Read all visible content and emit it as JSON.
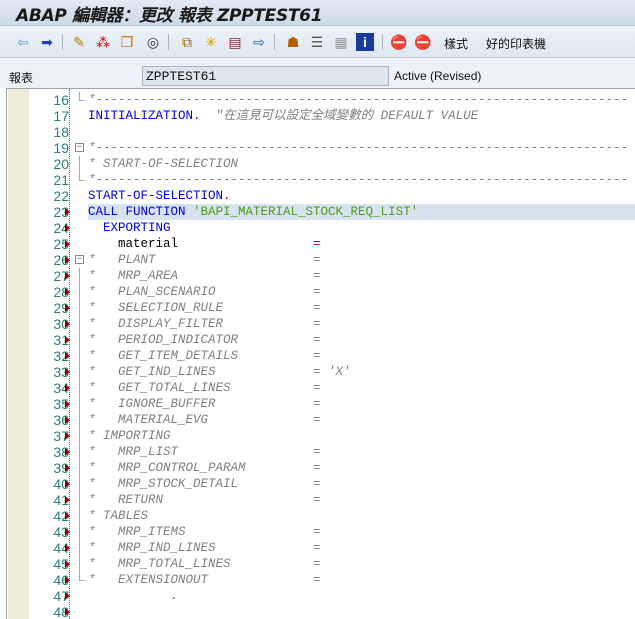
{
  "title": "ABAP 編輯器：更改 報表 ZPPTEST61",
  "toolbar": {
    "icons": [
      "back-arrow-icon",
      "forward-arrow-icon",
      "display-change-icon",
      "active-inactive-icon",
      "other-object-icon",
      "check-icon",
      "activate-icon",
      "test-icon",
      "where-used-icon",
      "navigation-window-icon",
      "object-list-icon",
      "help-icon",
      "info-icon",
      "breakpoint-icon",
      "session-breakpoint-icon"
    ],
    "pattern_label": "樣式",
    "pretty_printer_label": "好的印表機"
  },
  "info": {
    "label": "報表",
    "program": "ZPPTEST61",
    "status": "Active (Revised)"
  },
  "colors": {
    "keyword": "#0000e6",
    "string": "#4a9e1a",
    "comment": "#808080",
    "operator": "#a0006e",
    "highlight": "#d8e3f0"
  },
  "lines": [
    {
      "n": "16",
      "segs": [
        [
          "cmt",
          "*-----------------------------------------------------------------------"
        ]
      ]
    },
    {
      "n": "17",
      "segs": [
        [
          "kw",
          "INITIALIZATION"
        ],
        [
          "op",
          "."
        ],
        [
          "pl",
          "  "
        ],
        [
          "cmt",
          "\"在這見可以設定全域變數的 DEFAULT VALUE"
        ]
      ]
    },
    {
      "n": "18",
      "segs": []
    },
    {
      "n": "19",
      "segs": [
        [
          "cmt",
          "*-----------------------------------------------------------------------"
        ]
      ]
    },
    {
      "n": "20",
      "segs": [
        [
          "cmt",
          "* START-OF-SELECTION"
        ]
      ]
    },
    {
      "n": "21",
      "segs": [
        [
          "cmt",
          "*-----------------------------------------------------------------------"
        ]
      ]
    },
    {
      "n": "22",
      "segs": [
        [
          "kw",
          "START-OF-SELECTION"
        ],
        [
          "op",
          "."
        ]
      ]
    },
    {
      "n": "23",
      "segs": [
        [
          "kw",
          "CALL FUNCTION "
        ],
        [
          "str",
          "'BAPI_MATERIAL_STOCK_REQ_LIST'"
        ]
      ]
    },
    {
      "n": "24",
      "segs": [
        [
          "kw",
          "  EXPORTING"
        ]
      ]
    },
    {
      "n": "25",
      "segs": [
        [
          "pl",
          "    material                  "
        ],
        [
          "op",
          "="
        ]
      ]
    },
    {
      "n": "26",
      "segs": [
        [
          "cmt",
          "*   PLANT                     ="
        ]
      ]
    },
    {
      "n": "27",
      "segs": [
        [
          "cmt",
          "*   MRP_AREA                  ="
        ]
      ]
    },
    {
      "n": "28",
      "segs": [
        [
          "cmt",
          "*   PLAN_SCENARIO             ="
        ]
      ]
    },
    {
      "n": "29",
      "segs": [
        [
          "cmt",
          "*   SELECTION_RULE            ="
        ]
      ]
    },
    {
      "n": "30",
      "segs": [
        [
          "cmt",
          "*   DISPLAY_FILTER            ="
        ]
      ]
    },
    {
      "n": "31",
      "segs": [
        [
          "cmt",
          "*   PERIOD_INDICATOR          ="
        ]
      ]
    },
    {
      "n": "32",
      "segs": [
        [
          "cmt",
          "*   GET_ITEM_DETAILS          ="
        ]
      ]
    },
    {
      "n": "33",
      "segs": [
        [
          "cmt",
          "*   GET_IND_LINES             = 'X'"
        ]
      ]
    },
    {
      "n": "34",
      "segs": [
        [
          "cmt",
          "*   GET_TOTAL_LINES           ="
        ]
      ]
    },
    {
      "n": "35",
      "segs": [
        [
          "cmt",
          "*   IGNORE_BUFFER             ="
        ]
      ]
    },
    {
      "n": "36",
      "segs": [
        [
          "cmt",
          "*   MATERIAL_EVG              ="
        ]
      ]
    },
    {
      "n": "37",
      "segs": [
        [
          "cmt",
          "* IMPORTING"
        ]
      ]
    },
    {
      "n": "38",
      "segs": [
        [
          "cmt",
          "*   MRP_LIST                  ="
        ]
      ]
    },
    {
      "n": "39",
      "segs": [
        [
          "cmt",
          "*   MRP_CONTROL_PARAM         ="
        ]
      ]
    },
    {
      "n": "40",
      "segs": [
        [
          "cmt",
          "*   MRP_STOCK_DETAIL          ="
        ]
      ]
    },
    {
      "n": "41",
      "segs": [
        [
          "cmt",
          "*   RETURN                    ="
        ]
      ]
    },
    {
      "n": "42",
      "segs": [
        [
          "cmt",
          "* TABLES"
        ]
      ]
    },
    {
      "n": "43",
      "segs": [
        [
          "cmt",
          "*   MRP_ITEMS                 ="
        ]
      ]
    },
    {
      "n": "44",
      "segs": [
        [
          "cmt",
          "*   MRP_IND_LINES             ="
        ]
      ]
    },
    {
      "n": "45",
      "segs": [
        [
          "cmt",
          "*   MRP_TOTAL_LINES           ="
        ]
      ]
    },
    {
      "n": "46",
      "segs": [
        [
          "cmt",
          "*   EXTENSIONOUT              ="
        ]
      ]
    },
    {
      "n": "47",
      "segs": [
        [
          "cmt",
          "           ."
        ]
      ]
    },
    {
      "n": "48",
      "segs": []
    }
  ]
}
